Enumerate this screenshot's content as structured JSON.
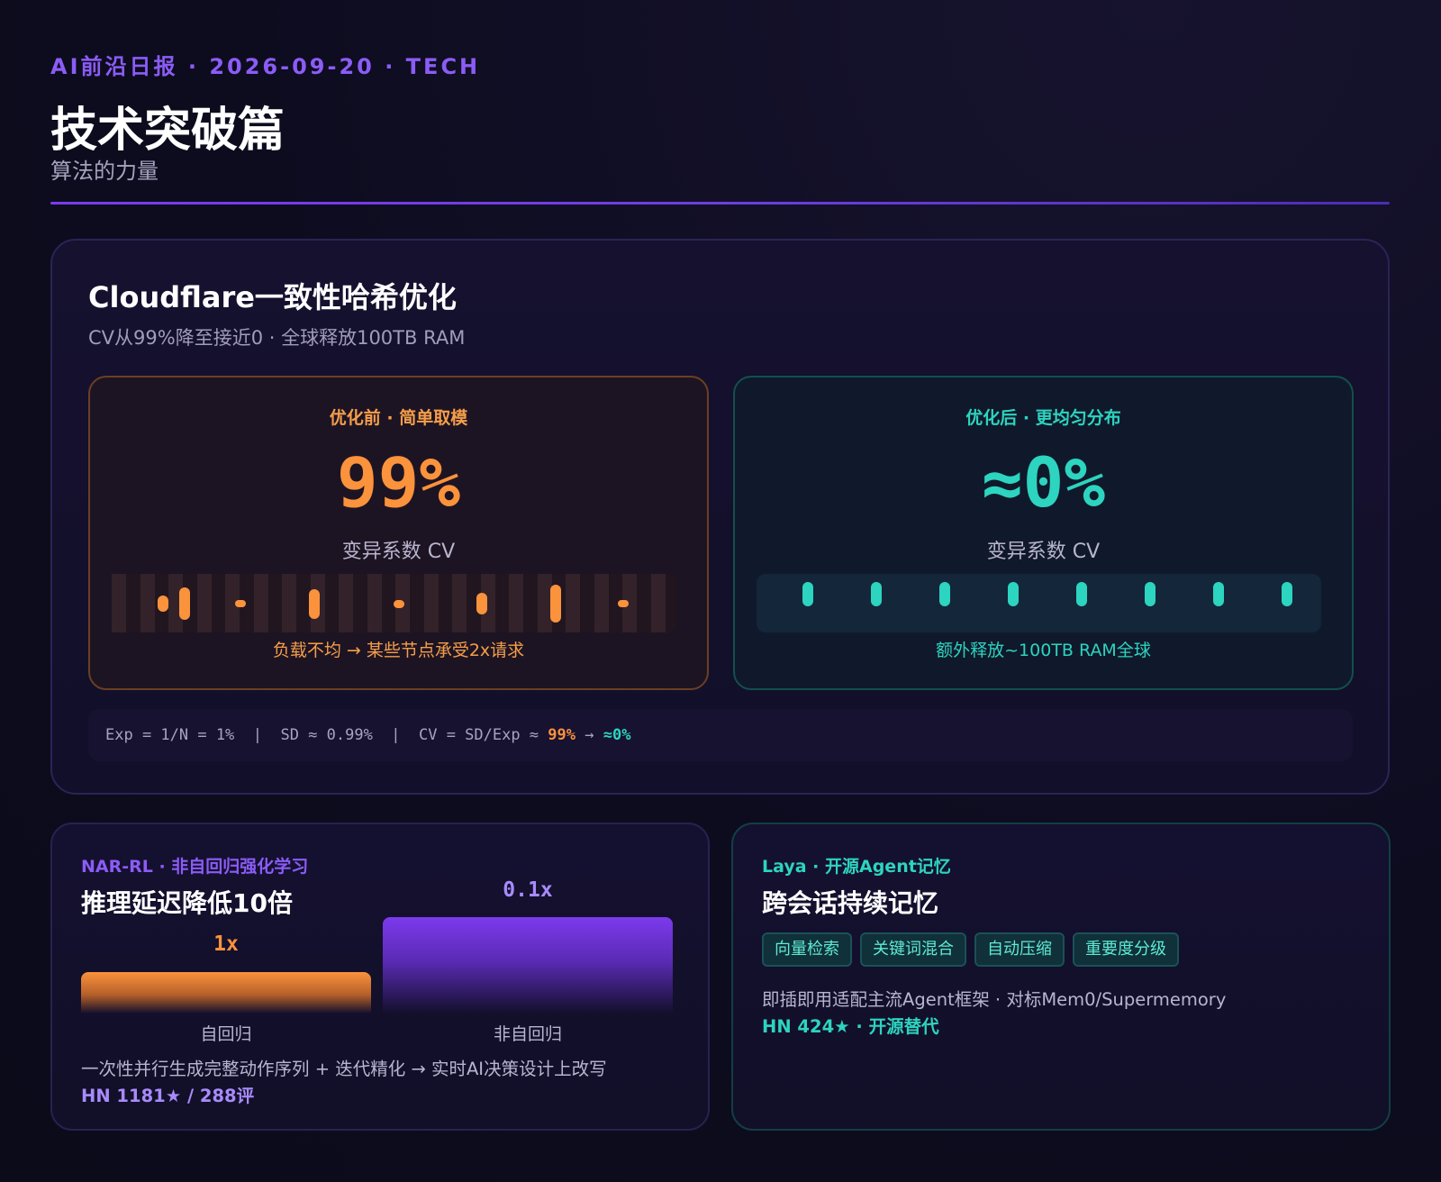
{
  "header": {
    "kicker": "AI前沿日报 · 2026-09-20 · TECH",
    "title": "技术突破篇",
    "subtitle": "算法的力量"
  },
  "cloudflare": {
    "title": "Cloudflare一致性哈希优化",
    "subtitle": "CV从99%降至接近0 · 全球释放100TB RAM",
    "before": {
      "heading": "优化前 · 简单取模",
      "value": "99%",
      "metric_label": "变异系数 CV",
      "footer": "负载不均 → 某些节点承受2x请求",
      "node_loads": [
        0.3,
        0.6,
        0.1,
        0.55,
        0.15,
        0.4,
        0.7,
        0.05
      ]
    },
    "after": {
      "heading": "优化后 · 更均匀分布",
      "value": "≈0%",
      "metric_label": "变异系数 CV",
      "footer": "额外释放~100TB RAM全球",
      "node_loads": [
        0.4,
        0.4,
        0.4,
        0.4,
        0.4,
        0.4,
        0.4,
        0.4
      ]
    },
    "formula": {
      "prefix": "Exp = 1/N = 1%  |  SD ≈ 0.99%  |  CV = SD/Exp ≈ ",
      "before": "99%",
      "arrow": " → ",
      "after": "≈0%"
    },
    "colors": {
      "before": "#fb923c",
      "after": "#2dd4bf"
    }
  },
  "narrl": {
    "kicker": "NAR-RL · 非自回归强化学习",
    "title": "推理延迟降低10倍",
    "bars": [
      {
        "label": "1x",
        "caption": "自回归"
      },
      {
        "label": "0.1x",
        "caption": "非自回归"
      }
    ],
    "description": "一次性并行生成完整动作序列 + 迭代精化 → 实时AI决策设计上改写",
    "meta": "HN 1181★ / 288评"
  },
  "laya": {
    "kicker": "Laya · 开源Agent记忆",
    "title": "跨会话持续记忆",
    "tags": [
      "向量检索",
      "关键词混合",
      "自动压缩",
      "重要度分级"
    ],
    "description": "即插即用适配主流Agent框架 · 对标Mem0/Supermemory",
    "meta": "HN 424★ · 开源替代"
  }
}
